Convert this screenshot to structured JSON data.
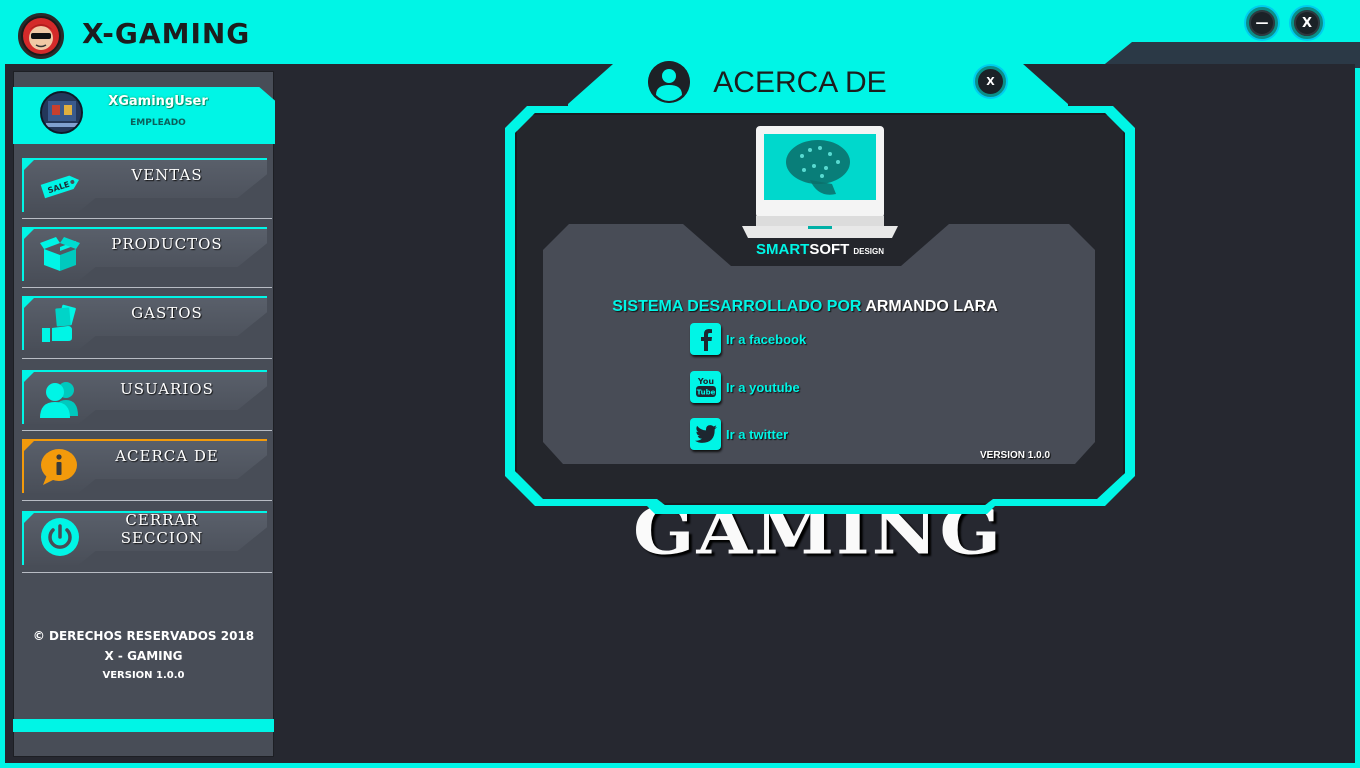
{
  "window": {
    "title": "X-GAMING",
    "minimize_label": "—",
    "close_label": "X"
  },
  "colors": {
    "accent": "#00f5e6",
    "active": "#f39a0b",
    "sidebar": "#484d57",
    "background": "#262830"
  },
  "user": {
    "name": "XGamingUser",
    "role": "EMPLEADO"
  },
  "sidebar": {
    "items": [
      {
        "label": "VENTAS",
        "icon": "sale-tag-icon"
      },
      {
        "label": "PRODUCTOS",
        "icon": "box-icon"
      },
      {
        "label": "GASTOS",
        "icon": "money-hand-icon"
      },
      {
        "label": "USUARIOS",
        "icon": "users-icon"
      },
      {
        "label": "ACERCA DE",
        "icon": "info-icon",
        "active": true
      },
      {
        "label": "CERRAR SECCION",
        "icon": "power-icon"
      }
    ],
    "sale_tag_text": "SALE"
  },
  "footer": {
    "copyright": "© DERECHOS RESERVADOS 2018",
    "brand": "X - GAMING",
    "version": "VERSION 1.0.0"
  },
  "about": {
    "title": "ACERCA DE",
    "close_label": "X",
    "brand_part1": "SMART",
    "brand_part2": "SOFT",
    "brand_part3": "DESIGN",
    "credit_prefix": "SISTEMA DESARROLLADO POR",
    "credit_name": "ARMANDO LARA",
    "links": [
      {
        "label": "Ir a facebook",
        "icon": "facebook-icon"
      },
      {
        "label": "Ir a youtube",
        "icon": "youtube-icon"
      },
      {
        "label": "Ir a twitter",
        "icon": "twitter-icon"
      }
    ],
    "youtube_badge_top": "You",
    "youtube_badge_bottom": "Tube",
    "version": "VERSION 1.0.0",
    "background_word": "GAMING"
  }
}
